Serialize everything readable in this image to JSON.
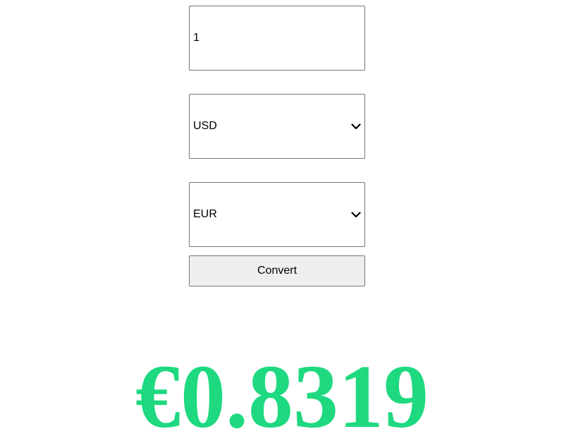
{
  "amount": {
    "value": "1"
  },
  "from_currency": {
    "selected": "USD"
  },
  "to_currency": {
    "selected": "EUR"
  },
  "convert_button": {
    "label": "Convert"
  },
  "result": {
    "text": "€0.8319",
    "color": "#1ed97f"
  },
  "icons": {
    "select_arrow": "chevron-down-icon"
  }
}
